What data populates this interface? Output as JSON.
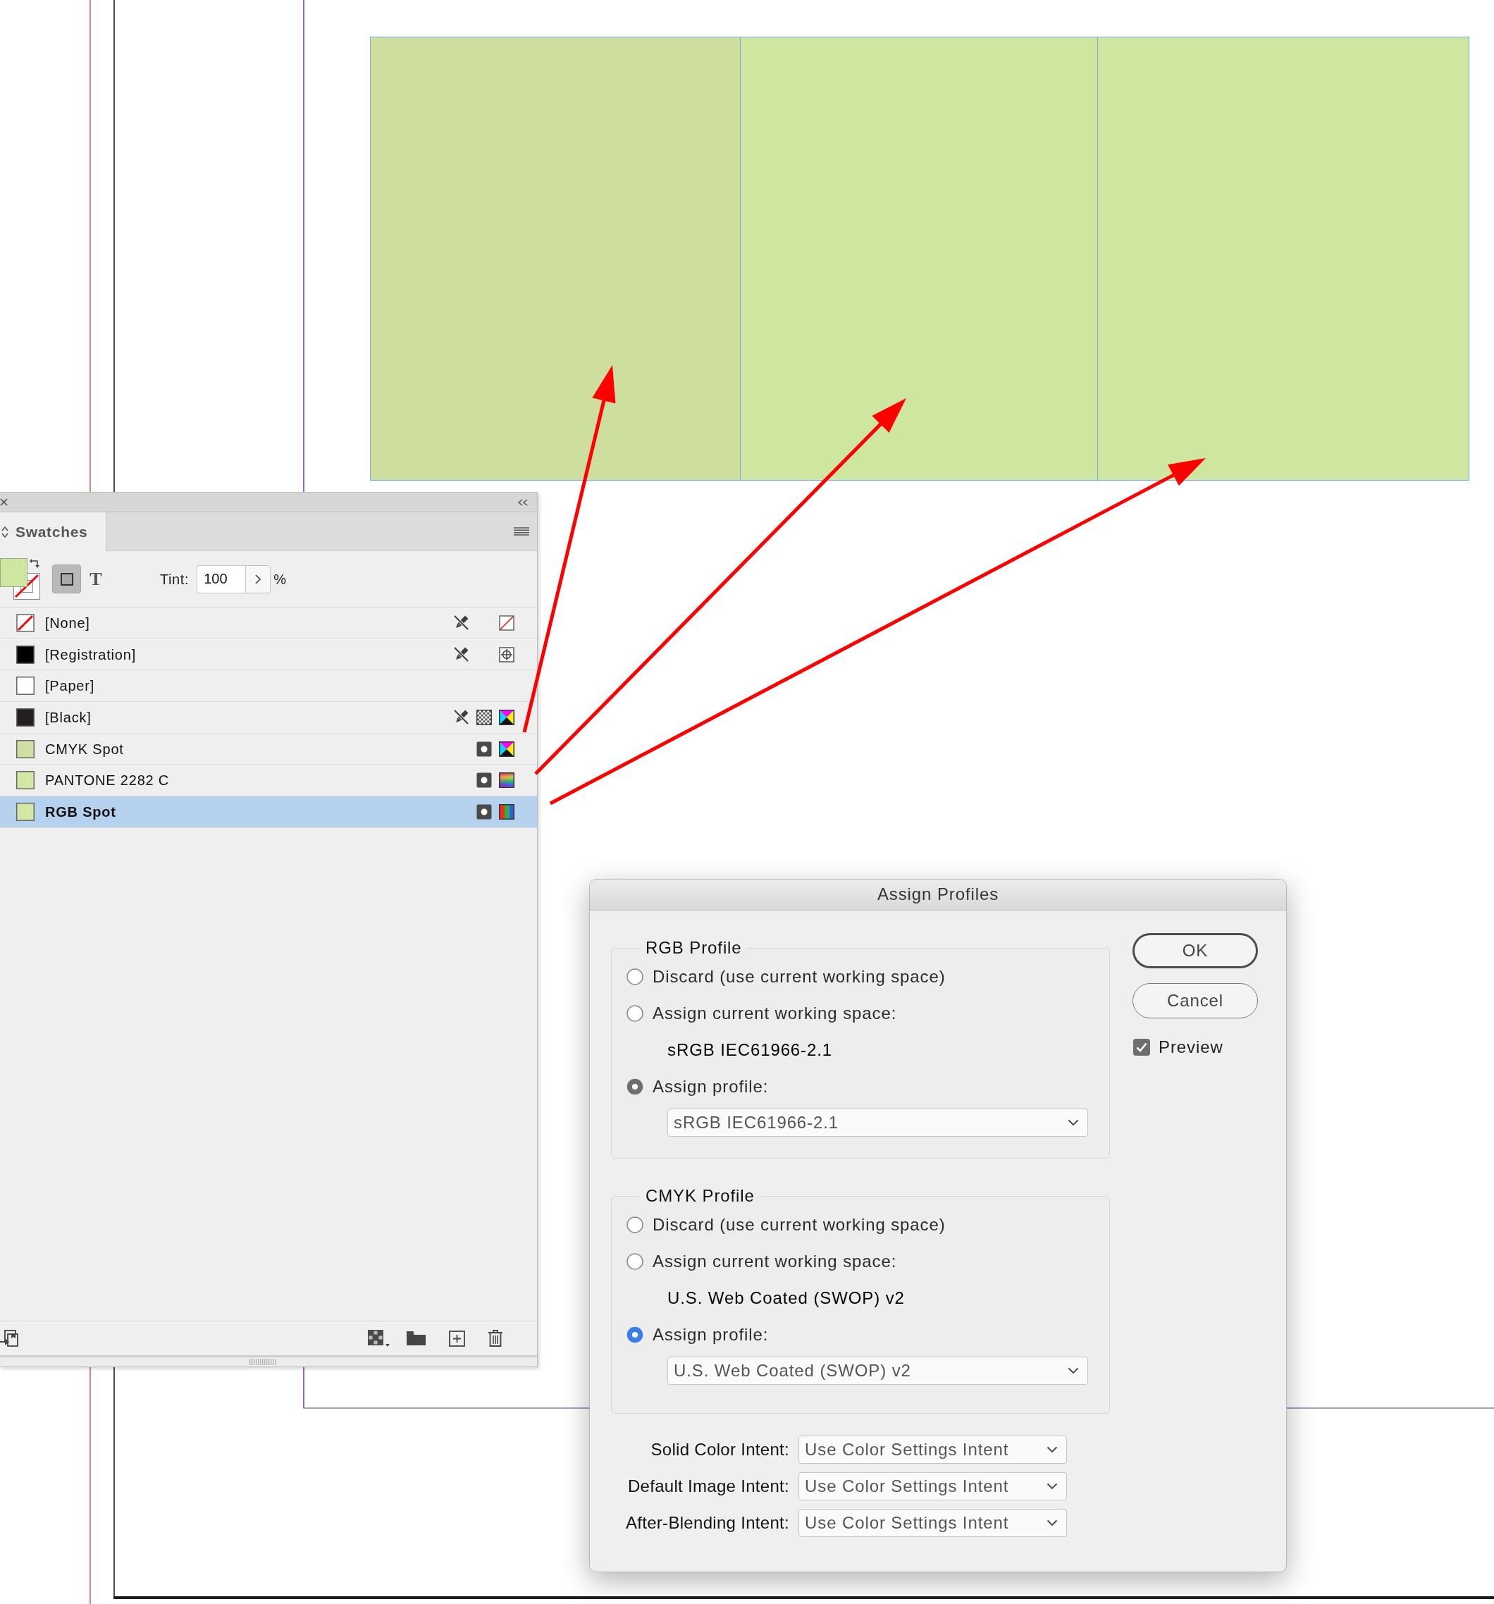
{
  "canvas": {
    "frames": [
      {
        "color": "#cdde9e"
      },
      {
        "color": "#cfe6a0"
      },
      {
        "color": "#cfe6a0"
      }
    ]
  },
  "swatches_panel": {
    "title": "Swatches",
    "format_targets": [
      {
        "kind": "container",
        "selected": true
      },
      {
        "kind": "text",
        "label": "T",
        "selected": false
      }
    ],
    "tint": {
      "label": "Tint:",
      "value": "100",
      "unit": "%"
    },
    "rows": [
      {
        "kind": "none",
        "name": "[None]",
        "selected": false,
        "locked": true,
        "icons": [
          {
            "kind": "no-color"
          }
        ]
      },
      {
        "kind": "color",
        "name": "[Registration]",
        "color": "#000000",
        "selected": false,
        "locked": true,
        "icons": [
          {
            "kind": "registration"
          }
        ]
      },
      {
        "kind": "color",
        "name": "[Paper]",
        "color": "#ffffff",
        "selected": false,
        "locked": false
      },
      {
        "kind": "color",
        "name": "[Black]",
        "color": "#231f20",
        "selected": false,
        "locked": true,
        "icons": [
          {
            "kind": "process"
          },
          {
            "kind": "cmyk"
          }
        ]
      },
      {
        "kind": "color",
        "name": "CMYK Spot",
        "color": "#d0dfa3",
        "selected": false,
        "locked": false,
        "icons": [
          {
            "kind": "spot"
          },
          {
            "kind": "cmyk"
          }
        ]
      },
      {
        "kind": "color",
        "name": "PANTONE 2282 C",
        "color": "#d4e8a5",
        "selected": false,
        "locked": false,
        "icons": [
          {
            "kind": "spot"
          },
          {
            "kind": "lab"
          }
        ]
      },
      {
        "kind": "color",
        "name": "RGB Spot",
        "color": "#d4e8a5",
        "selected": true,
        "locked": false,
        "icons": [
          {
            "kind": "spot"
          },
          {
            "kind": "rgb"
          }
        ]
      }
    ]
  },
  "dialog": {
    "title": "Assign Profiles",
    "groups": [
      {
        "legend": "RGB Profile",
        "focused": false,
        "options": [
          {
            "label": "Discard (use current working space)",
            "selected": false
          },
          {
            "label": "Assign current working space:",
            "selected": false,
            "detail": "sRGB IEC61966-2.1"
          },
          {
            "label": "Assign profile:",
            "selected": true,
            "dropdown": "sRGB IEC61966-2.1"
          }
        ]
      },
      {
        "legend": "CMYK Profile",
        "focused": true,
        "options": [
          {
            "label": "Discard (use current working space)",
            "selected": false
          },
          {
            "label": "Assign current working space:",
            "selected": false,
            "detail": "U.S. Web Coated (SWOP) v2"
          },
          {
            "label": "Assign profile:",
            "selected": true,
            "dropdown": "U.S. Web Coated (SWOP) v2"
          }
        ]
      }
    ],
    "intents": [
      {
        "label": "Solid Color Intent:",
        "value": "Use Color Settings Intent"
      },
      {
        "label": "Default Image Intent:",
        "value": "Use Color Settings Intent"
      },
      {
        "label": "After-Blending Intent:",
        "value": "Use Color Settings Intent"
      }
    ],
    "buttons": [
      {
        "label": "OK",
        "default": true
      },
      {
        "label": "Cancel",
        "default": false
      }
    ],
    "preview": {
      "label": "Preview",
      "checked": true
    }
  }
}
